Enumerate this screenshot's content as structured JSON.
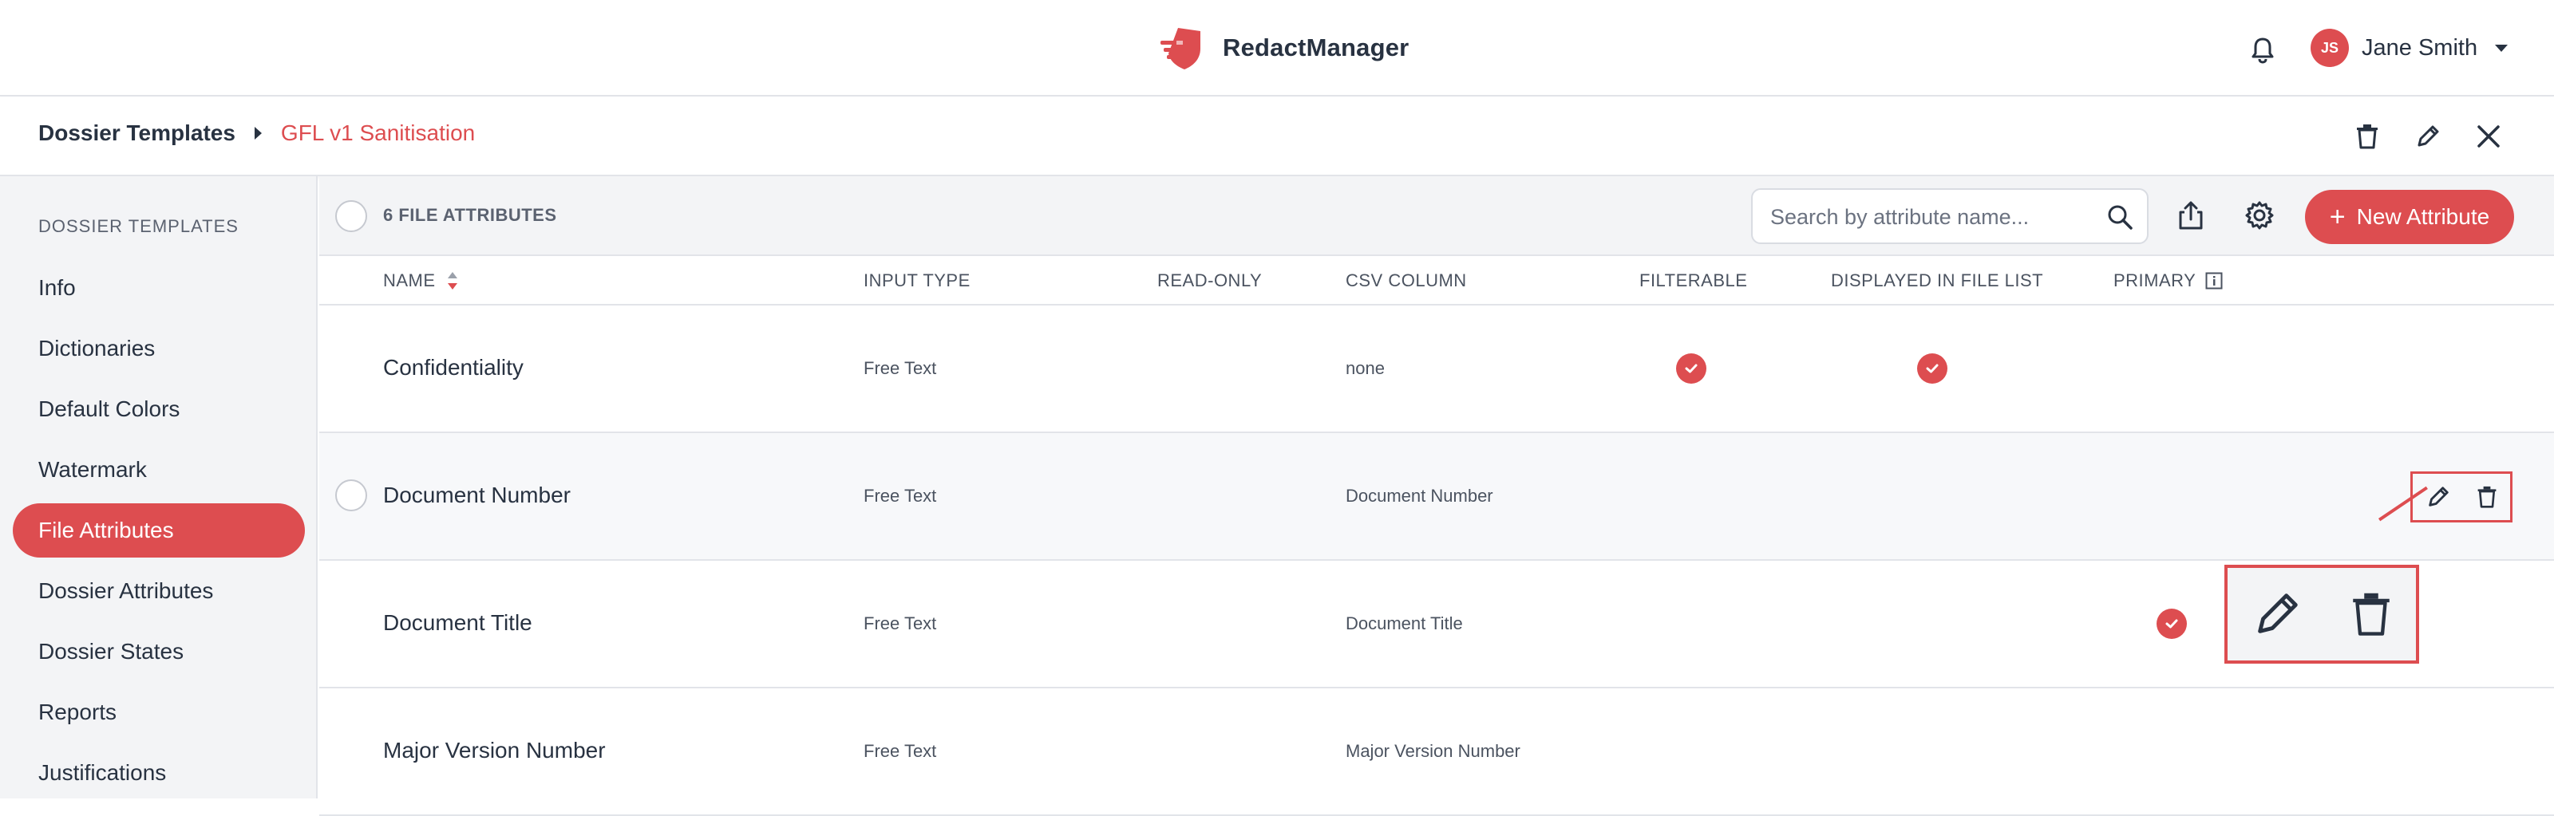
{
  "header": {
    "brand": "RedactManager",
    "user": {
      "initials": "JS",
      "name": "Jane Smith"
    }
  },
  "breadcrumb": {
    "root": "Dossier Templates",
    "current": "GFL v1 Sanitisation"
  },
  "sidebar": {
    "title": "DOSSIER TEMPLATES",
    "items": [
      {
        "label": "Info"
      },
      {
        "label": "Dictionaries"
      },
      {
        "label": "Default Colors"
      },
      {
        "label": "Watermark"
      },
      {
        "label": "File Attributes",
        "active": true
      },
      {
        "label": "Dossier Attributes"
      },
      {
        "label": "Dossier States"
      },
      {
        "label": "Reports"
      },
      {
        "label": "Justifications"
      }
    ]
  },
  "toolbar": {
    "count_label": "6 FILE ATTRIBUTES",
    "search_placeholder": "Search by attribute name...",
    "new_button_label": "New Attribute"
  },
  "table": {
    "columns": {
      "name": "NAME",
      "input_type": "INPUT TYPE",
      "read_only": "READ-ONLY",
      "csv_column": "CSV COLUMN",
      "filterable": "FILTERABLE",
      "displayed": "DISPLAYED IN FILE LIST",
      "primary": "PRIMARY"
    },
    "rows": [
      {
        "name": "Confidentiality",
        "input_type": "Free Text",
        "csv_column": "none",
        "read_only": false,
        "filterable": true,
        "displayed": true,
        "primary": false
      },
      {
        "name": "Document Number",
        "input_type": "Free Text",
        "csv_column": "Document Number",
        "read_only": false,
        "filterable": false,
        "displayed": false,
        "primary": false
      },
      {
        "name": "Document Title",
        "input_type": "Free Text",
        "csv_column": "Document Title",
        "read_only": false,
        "filterable": false,
        "displayed": false,
        "primary": true
      },
      {
        "name": "Major Version Number",
        "input_type": "Free Text",
        "csv_column": "Major Version Number",
        "read_only": false,
        "filterable": false,
        "displayed": false,
        "primary": false
      }
    ]
  },
  "colors": {
    "accent": "#dd4d50",
    "text": "#283241",
    "sidebar_bg": "#f3f4f6"
  }
}
